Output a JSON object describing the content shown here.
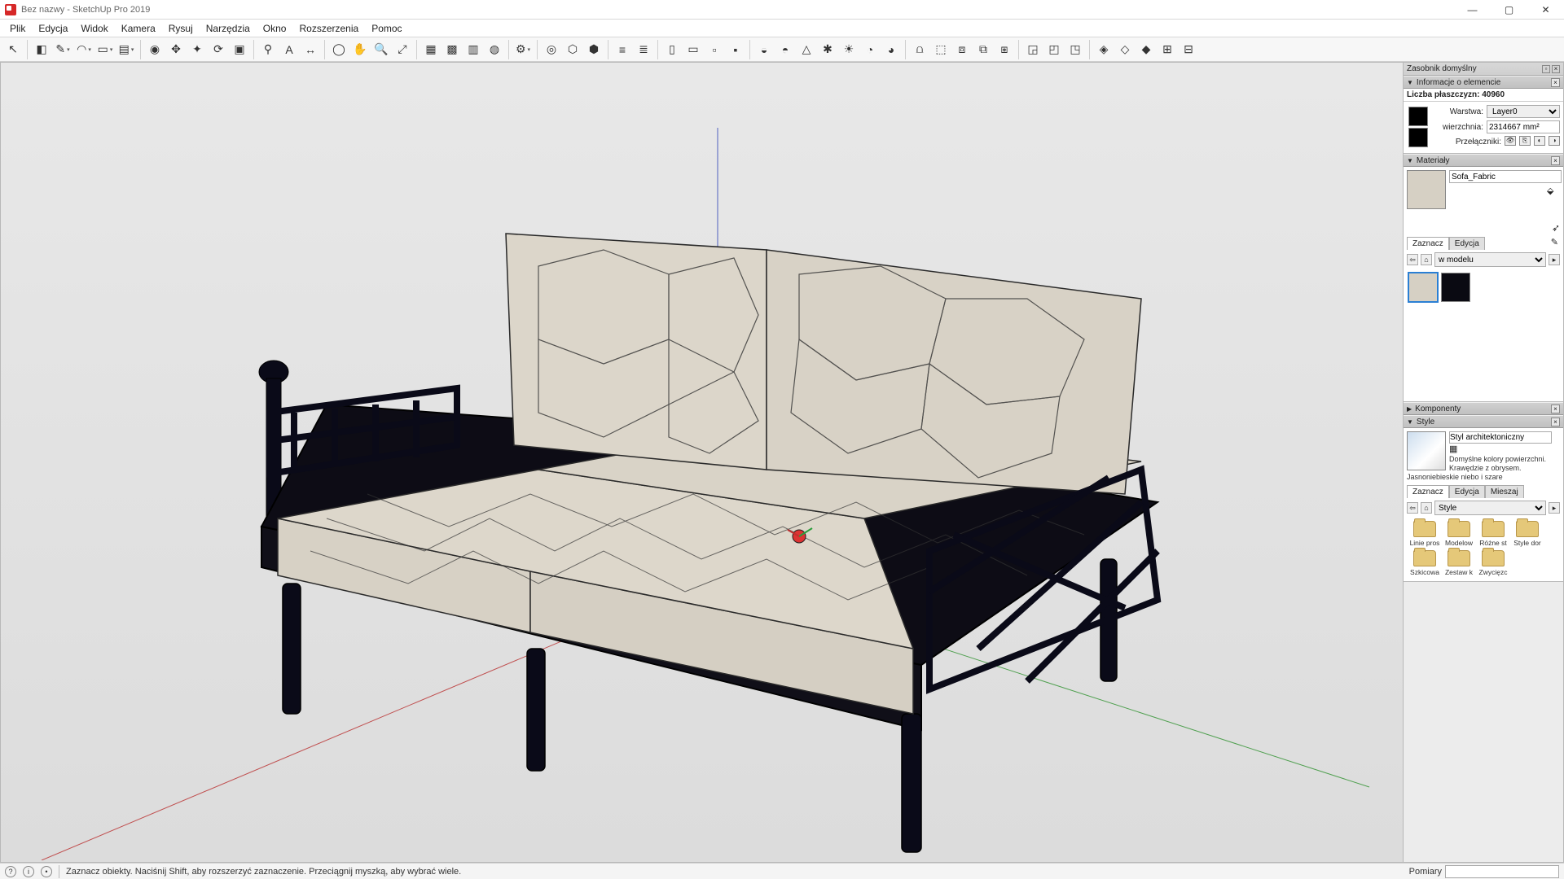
{
  "title": "Bez nazwy - SketchUp Pro 2019",
  "menu": [
    "Plik",
    "Edycja",
    "Widok",
    "Kamera",
    "Rysuj",
    "Narzędzia",
    "Okno",
    "Rozszerzenia",
    "Pomoc"
  ],
  "toolbar_icons": [
    {
      "n": "select",
      "g": "↖"
    },
    {
      "sep": true
    },
    {
      "n": "eraser",
      "g": "◧"
    },
    {
      "n": "line",
      "g": "✎",
      "dd": true
    },
    {
      "n": "arc",
      "g": "◠",
      "dd": true
    },
    {
      "n": "shape",
      "g": "▭",
      "dd": true
    },
    {
      "n": "pushpull",
      "g": "▤",
      "dd": true
    },
    {
      "sep": true
    },
    {
      "n": "paint",
      "g": "◉"
    },
    {
      "n": "move",
      "g": "✥"
    },
    {
      "n": "rotate",
      "g": "✦"
    },
    {
      "n": "scale",
      "g": "⟳"
    },
    {
      "n": "offset",
      "g": "▣"
    },
    {
      "sep": true
    },
    {
      "n": "tape",
      "g": "⚲"
    },
    {
      "n": "text",
      "g": "A"
    },
    {
      "n": "dimension",
      "g": "↔"
    },
    {
      "sep": true
    },
    {
      "n": "orbit",
      "g": "◯"
    },
    {
      "n": "pan",
      "g": "✋"
    },
    {
      "n": "zoom",
      "g": "🔍"
    },
    {
      "n": "zoom-ext",
      "g": "⤢"
    },
    {
      "sep": true
    },
    {
      "n": "warehouse",
      "g": "▦"
    },
    {
      "n": "ext-wh",
      "g": "▩"
    },
    {
      "n": "layout",
      "g": "▥"
    },
    {
      "n": "style-builder",
      "g": "◍"
    },
    {
      "sep": true
    },
    {
      "n": "extmgr",
      "g": "⚙",
      "dd": true
    },
    {
      "sep": true
    },
    {
      "n": "solid1",
      "g": "◎"
    },
    {
      "n": "solid2",
      "g": "⬡"
    },
    {
      "n": "solid3",
      "g": "⬢"
    },
    {
      "sep": true
    },
    {
      "n": "section1",
      "g": "≡"
    },
    {
      "n": "section2",
      "g": "≣"
    },
    {
      "sep": true
    },
    {
      "n": "view-iso",
      "g": "▯"
    },
    {
      "n": "view-top",
      "g": "▭"
    },
    {
      "n": "view-front",
      "g": "▫"
    },
    {
      "n": "view-right",
      "g": "▪"
    },
    {
      "sep": true
    },
    {
      "n": "shadow1",
      "g": "◒"
    },
    {
      "n": "shadow2",
      "g": "◓"
    },
    {
      "n": "shadow3",
      "g": "△"
    },
    {
      "n": "shadow4",
      "g": "✱"
    },
    {
      "n": "shadow5",
      "g": "☀"
    },
    {
      "n": "shadow6",
      "g": "◔"
    },
    {
      "n": "shadow7",
      "g": "◕"
    },
    {
      "sep": true
    },
    {
      "n": "sandbox1",
      "g": "⩍"
    },
    {
      "n": "sandbox2",
      "g": "⬚"
    },
    {
      "n": "sandbox3",
      "g": "⧈"
    },
    {
      "n": "sandbox4",
      "g": "⧉"
    },
    {
      "n": "sandbox5",
      "g": "⧆"
    },
    {
      "sep": true
    },
    {
      "n": "bool1",
      "g": "◲"
    },
    {
      "n": "bool2",
      "g": "◰"
    },
    {
      "n": "bool3",
      "g": "◳"
    },
    {
      "sep": true
    },
    {
      "n": "camera1",
      "g": "◈"
    },
    {
      "n": "camera2",
      "g": "◇"
    },
    {
      "n": "camera3",
      "g": "◆"
    },
    {
      "n": "camera4",
      "g": "⊞"
    },
    {
      "n": "camera5",
      "g": "⊟"
    }
  ],
  "tray": {
    "title": "Zasobnik domyślny",
    "panels": {
      "entity_info": {
        "title": "Informacje o elemencie",
        "faces_label": "Liczba płaszczyzn:",
        "faces_value": "40960",
        "layer_label": "Warstwa:",
        "layer_value": "Layer0",
        "area_label": "wierzchnia:",
        "area_value": "2314667 mm²",
        "toggles_label": "Przełączniki:"
      },
      "materials": {
        "title": "Materiały",
        "name": "Sofa_Fabric",
        "tabs": {
          "select": "Zaznacz",
          "edit": "Edycja"
        },
        "scope": "w modelu",
        "swatches": [
          {
            "c": "#d6d0c4",
            "sel": true
          },
          {
            "c": "#0a0a12"
          }
        ]
      },
      "components": {
        "title": "Komponenty"
      },
      "styles": {
        "title": "Style",
        "name": "Styl architektoniczny",
        "desc": "Domyślne kolory powierzchni. Krawędzie z obrysem. Jasnoniebieskie niebo i szare",
        "tabs": {
          "select": "Zaznacz",
          "edit": "Edycja",
          "mix": "Mieszaj"
        },
        "scope": "Style",
        "folders": [
          "Linie pros",
          "Modelow",
          "Różne st",
          "Style dor",
          "Szkicowa",
          "Zestaw k",
          "Zwycięzc"
        ]
      }
    }
  },
  "status": {
    "hint": "Zaznacz obiekty. Naciśnij Shift, aby rozszerzyć zaznaczenie. Przeciągnij myszką, aby wybrać wiele.",
    "measure_label": "Pomiary"
  },
  "window_controls": {
    "min": "—",
    "max": "▢",
    "close": "✕"
  }
}
